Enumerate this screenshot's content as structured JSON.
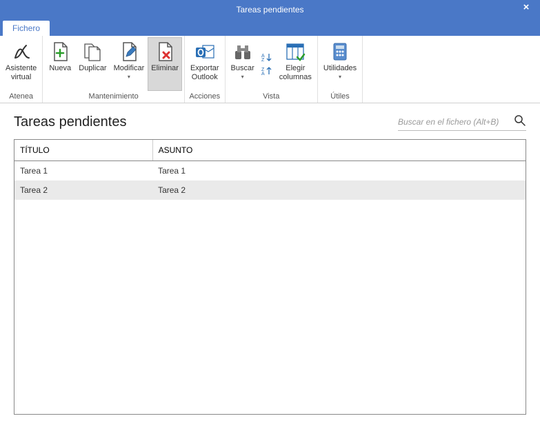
{
  "window": {
    "title": "Tareas pendientes",
    "close": "×"
  },
  "tabs": {
    "fichero": "Fichero"
  },
  "ribbon": {
    "atenea": {
      "label": "Atenea",
      "btn_asistente_l1": "Asistente",
      "btn_asistente_l2": "virtual"
    },
    "mantenimiento": {
      "label": "Mantenimiento",
      "nueva": "Nueva",
      "duplicar": "Duplicar",
      "modificar": "Modificar",
      "eliminar": "Eliminar"
    },
    "acciones": {
      "label": "Acciones",
      "exportar_l1": "Exportar",
      "exportar_l2": "Outlook"
    },
    "vista": {
      "label": "Vista",
      "buscar": "Buscar",
      "elegir_l1": "Elegir",
      "elegir_l2": "columnas"
    },
    "utiles": {
      "label": "Útiles",
      "utilidades": "Utilidades"
    }
  },
  "page": {
    "title": "Tareas pendientes",
    "search_placeholder": "Buscar en el fichero (Alt+B)"
  },
  "grid": {
    "columns": {
      "titulo": "TÍTULO",
      "asunto": "ASUNTO"
    },
    "rows": [
      {
        "titulo": "Tarea 1",
        "asunto": "Tarea 1"
      },
      {
        "titulo": "Tarea 2",
        "asunto": "Tarea 2"
      }
    ]
  }
}
